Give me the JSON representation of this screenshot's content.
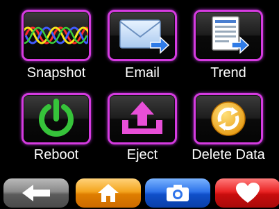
{
  "menu": {
    "items": [
      {
        "label": "Snapshot",
        "icon": "waveform-icon"
      },
      {
        "label": "Email",
        "icon": "email-icon"
      },
      {
        "label": "Trend",
        "icon": "trend-report-icon"
      },
      {
        "label": "Reboot",
        "icon": "power-icon"
      },
      {
        "label": "Eject",
        "icon": "eject-icon"
      },
      {
        "label": "Delete Data",
        "icon": "recycle-icon"
      }
    ]
  },
  "dock": {
    "buttons": [
      {
        "name": "back",
        "icon": "back-arrow-icon",
        "color": "#8a8a8a"
      },
      {
        "name": "home",
        "icon": "home-icon",
        "color": "#f4a51e"
      },
      {
        "name": "camera",
        "icon": "camera-icon",
        "color": "#2f74ea"
      },
      {
        "name": "favorite",
        "icon": "heart-icon",
        "color": "#ea2424"
      }
    ]
  },
  "colors": {
    "tile_border": "#d53be0",
    "background": "#000000",
    "label": "#ffffff"
  }
}
